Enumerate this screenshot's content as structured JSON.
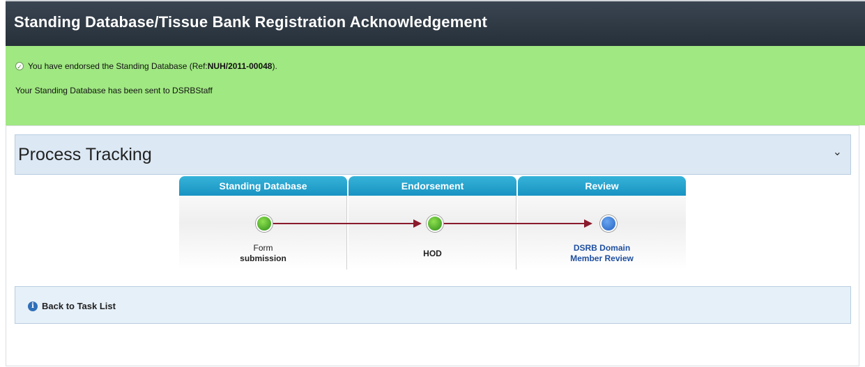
{
  "header": {
    "title": "Standing Database/Tissue Bank Registration Acknowledgement"
  },
  "message": {
    "line1_prefix": "You have endorsed the Standing Database (Ref: ",
    "ref_number": "NUH/2011-00048",
    "line1_suffix": ").",
    "line2": "Your Standing Database has been sent to DSRBStaff",
    "icon": "check-circle-icon"
  },
  "process_tracking": {
    "title": "Process Tracking",
    "toggle_icon": "chevron-down-icon",
    "stages": [
      {
        "header": "Standing Database",
        "label_line1": "Form",
        "label_line2": "submission",
        "status": "completed",
        "color": "#3aa020"
      },
      {
        "header": "Endorsement",
        "label_line1": "HOD",
        "label_line2": "",
        "status": "completed",
        "color": "#3aa020"
      },
      {
        "header": "Review",
        "label_line1": "DSRB Domain",
        "label_line2": "Member Review",
        "status": "current",
        "color": "#2a66c4"
      }
    ]
  },
  "footer": {
    "back_label": "Back to Task List",
    "icon": "info-icon"
  },
  "colors": {
    "header_bg": "#2e3944",
    "message_bg": "#a0e882",
    "stage_header": "#1e9ccb",
    "arrow": "#8a1a2c"
  }
}
